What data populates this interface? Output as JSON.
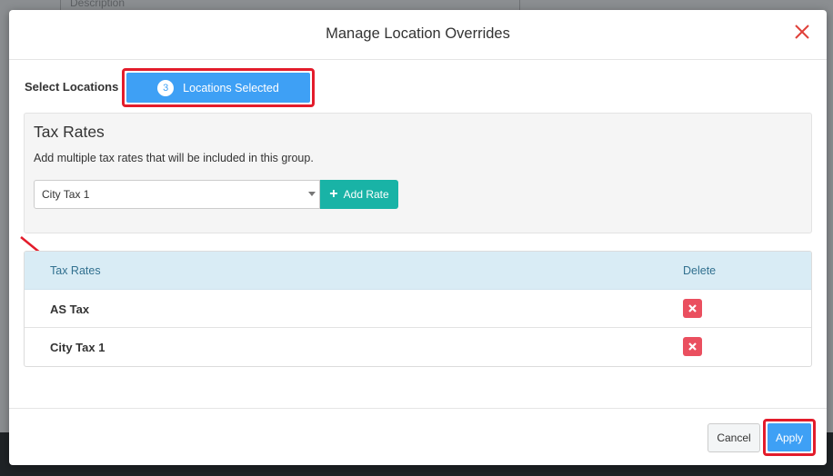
{
  "modal": {
    "title": "Manage Location Overrides"
  },
  "locations": {
    "label": "Select Locations",
    "count": "3",
    "button_label": "Locations Selected"
  },
  "tax_panel": {
    "heading": "Tax Rates",
    "description": "Add multiple tax rates that will be included in this group.",
    "selected_rate": "City Tax 1",
    "add_button_label": "Add Rate"
  },
  "table": {
    "headers": [
      "Tax Rates",
      "Delete"
    ],
    "rows": [
      {
        "name": "AS Tax"
      },
      {
        "name": "City Tax 1"
      }
    ]
  },
  "footer": {
    "cancel_label": "Cancel",
    "apply_label": "Apply"
  },
  "background": {
    "top_text": "Description"
  },
  "colors": {
    "primary": "#3ea0f5",
    "teal": "#19b3a6",
    "danger": "#ea4f5f",
    "highlight": "#e31c2b",
    "table_header_bg": "#d9ecf5"
  },
  "icons": {
    "close": "close-icon",
    "plus": "plus-icon",
    "delete": "times-icon",
    "arrow": "annotation-arrow-icon"
  }
}
